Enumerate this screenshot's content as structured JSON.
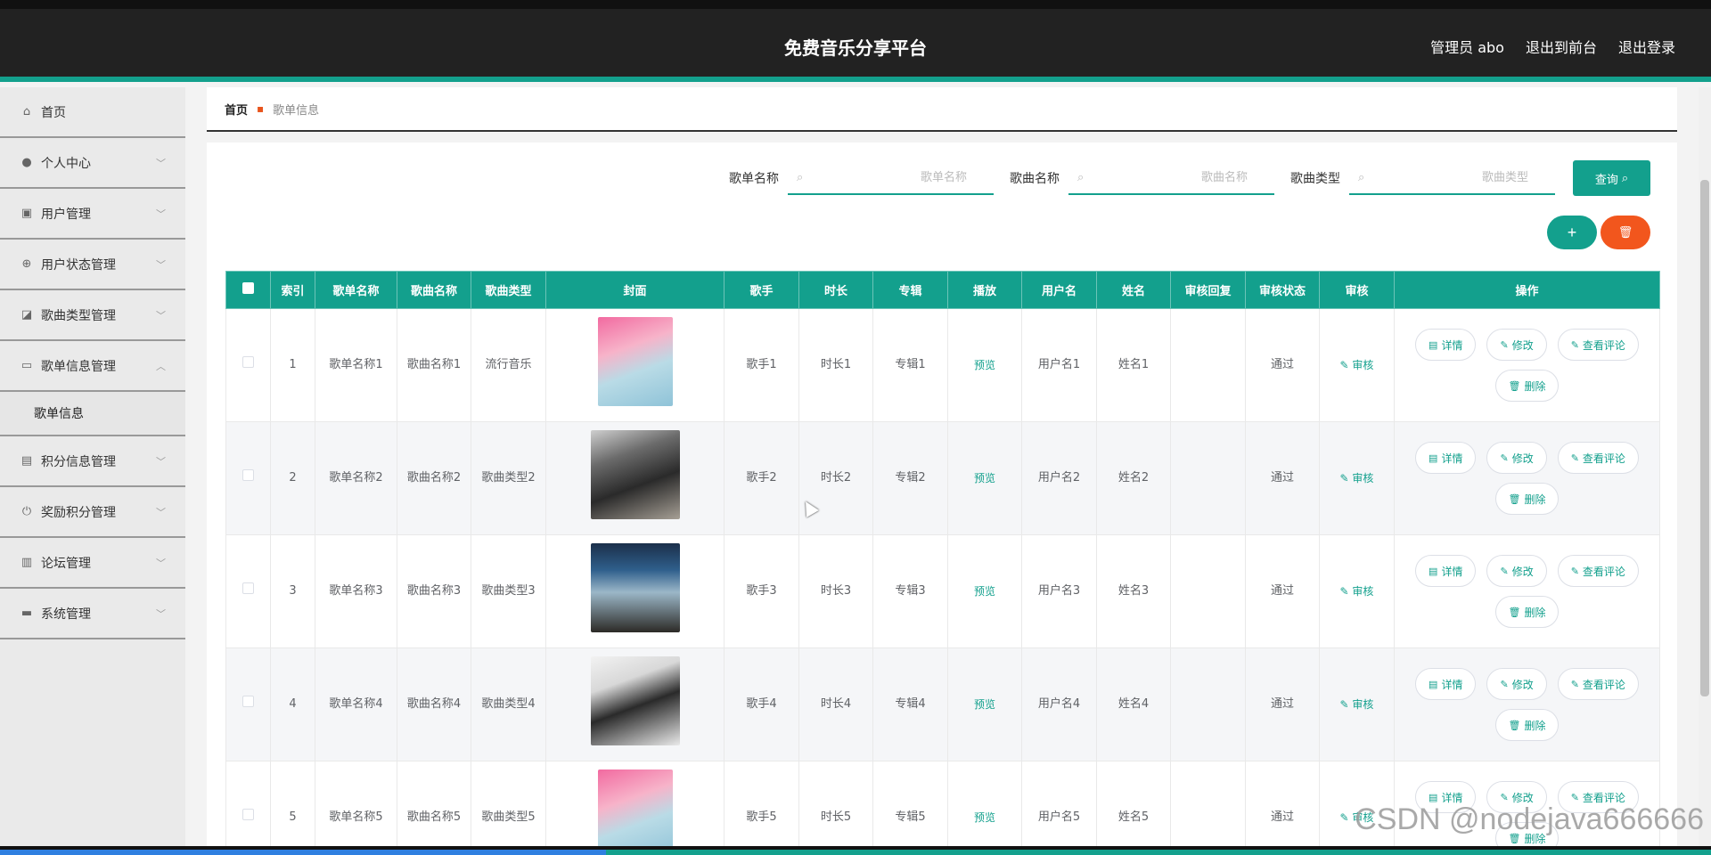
{
  "header": {
    "title": "免费音乐分享平台",
    "admin": "管理员 abo",
    "to_front": "退出到前台",
    "logout": "退出登录"
  },
  "sidebar": {
    "items": [
      {
        "label": "首页",
        "icon": "home-icon",
        "glyph": "⌂",
        "chevron": ""
      },
      {
        "label": "个人中心",
        "icon": "user-icon",
        "glyph": "●",
        "chevron": "﹀"
      },
      {
        "label": "用户管理",
        "icon": "users-icon",
        "glyph": "▣",
        "chevron": "﹀"
      },
      {
        "label": "用户状态管理",
        "icon": "target-icon",
        "glyph": "⊕",
        "chevron": "﹀"
      },
      {
        "label": "歌曲类型管理",
        "icon": "chart-icon",
        "glyph": "◪",
        "chevron": "﹀"
      },
      {
        "label": "歌单信息管理",
        "icon": "monitor-icon",
        "glyph": "▭",
        "chevron": "︿"
      },
      {
        "label": "积分信息管理",
        "icon": "clipboard-icon",
        "glyph": "▤",
        "chevron": "﹀"
      },
      {
        "label": "奖励积分管理",
        "icon": "power-icon",
        "glyph": "⏻",
        "chevron": "﹀"
      },
      {
        "label": "论坛管理",
        "icon": "forum-icon",
        "glyph": "▥",
        "chevron": "﹀"
      },
      {
        "label": "系统管理",
        "icon": "briefcase-icon",
        "glyph": "▬",
        "chevron": "﹀"
      }
    ],
    "submenu": "歌单信息"
  },
  "breadcrumb": {
    "home": "首页",
    "current": "歌单信息"
  },
  "search": {
    "fields": [
      {
        "label": "歌单名称",
        "placeholder": "歌单名称"
      },
      {
        "label": "歌曲名称",
        "placeholder": "歌曲名称"
      },
      {
        "label": "歌曲类型",
        "placeholder": "歌曲类型"
      }
    ],
    "query_label": "查询"
  },
  "actions": {
    "add": "+",
    "delete": "🗑"
  },
  "table": {
    "columns": [
      "",
      "索引",
      "歌单名称",
      "歌曲名称",
      "歌曲类型",
      "封面",
      "歌手",
      "时长",
      "专辑",
      "播放",
      "用户名",
      "姓名",
      "审核回复",
      "审核状态",
      "审核",
      "操作"
    ],
    "rows": [
      {
        "index": "1",
        "playlist": "歌单名称1",
        "song": "歌曲名称1",
        "type": "流行音乐",
        "cover": "pink",
        "singer": "歌手1",
        "duration": "时长1",
        "album": "专辑1",
        "play": "预览",
        "username": "用户名1",
        "name": "姓名1",
        "reply": "",
        "status": "通过",
        "audit": "审核"
      },
      {
        "index": "2",
        "playlist": "歌单名称2",
        "song": "歌曲名称2",
        "type": "歌曲类型2",
        "cover": "dark",
        "singer": "歌手2",
        "duration": "时长2",
        "album": "专辑2",
        "play": "预览",
        "username": "用户名2",
        "name": "姓名2",
        "reply": "",
        "status": "通过",
        "audit": "审核"
      },
      {
        "index": "3",
        "playlist": "歌单名称3",
        "song": "歌曲名称3",
        "type": "歌曲类型3",
        "cover": "blue",
        "singer": "歌手3",
        "duration": "时长3",
        "album": "专辑3",
        "play": "预览",
        "username": "用户名3",
        "name": "姓名3",
        "reply": "",
        "status": "通过",
        "audit": "审核"
      },
      {
        "index": "4",
        "playlist": "歌单名称4",
        "song": "歌曲名称4",
        "type": "歌曲类型4",
        "cover": "bw",
        "singer": "歌手4",
        "duration": "时长4",
        "album": "专辑4",
        "play": "预览",
        "username": "用户名4",
        "name": "姓名4",
        "reply": "",
        "status": "通过",
        "audit": "审核"
      },
      {
        "index": "5",
        "playlist": "歌单名称5",
        "song": "歌曲名称5",
        "type": "歌曲类型5",
        "cover": "pink",
        "singer": "歌手5",
        "duration": "时长5",
        "album": "专辑5",
        "play": "预览",
        "username": "用户名5",
        "name": "姓名5",
        "reply": "",
        "status": "通过",
        "audit": "审核"
      }
    ],
    "ops": {
      "detail": "详情",
      "edit": "修改",
      "comments": "查看评论",
      "delete": "删除"
    }
  },
  "watermark": "CSDN @nodejava666666",
  "colors": {
    "accent": "#13a08d",
    "danger": "#f2561d",
    "topbar": "#222222"
  }
}
